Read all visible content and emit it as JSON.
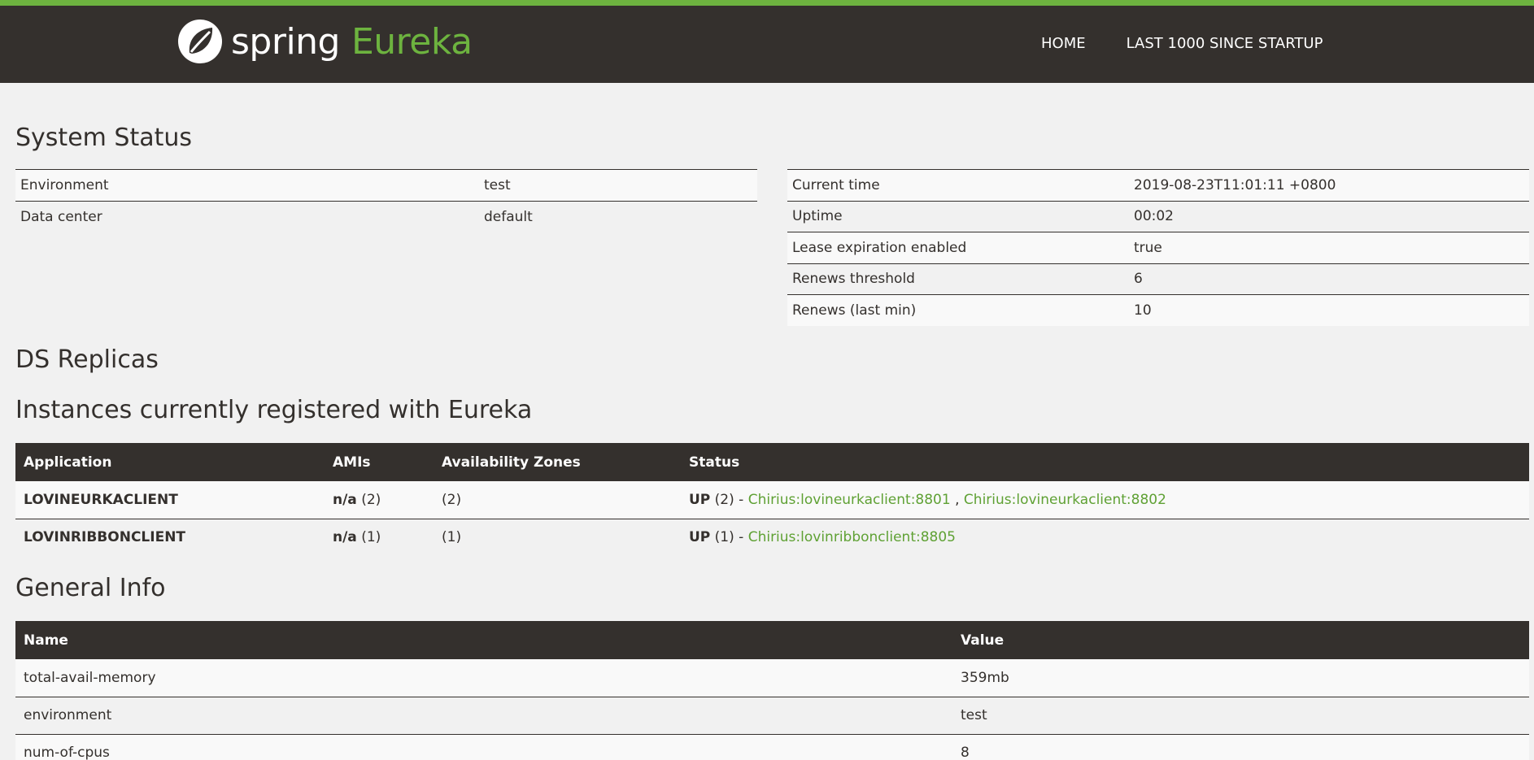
{
  "header": {
    "logo_word1": "spring",
    "logo_word2": "Eureka",
    "nav": [
      "HOME",
      "LAST 1000 SINCE STARTUP"
    ]
  },
  "system_status": {
    "title": "System Status",
    "left": [
      {
        "label": "Environment",
        "value": "test"
      },
      {
        "label": "Data center",
        "value": "default"
      }
    ],
    "right": [
      {
        "label": "Current time",
        "value": "2019-08-23T11:01:11 +0800"
      },
      {
        "label": "Uptime",
        "value": "00:02"
      },
      {
        "label": "Lease expiration enabled",
        "value": "true"
      },
      {
        "label": "Renews threshold",
        "value": "6"
      },
      {
        "label": "Renews (last min)",
        "value": "10"
      }
    ]
  },
  "ds_replicas": {
    "title": "DS Replicas"
  },
  "instances": {
    "title": "Instances currently registered with Eureka",
    "headers": [
      "Application",
      "AMIs",
      "Availability Zones",
      "Status"
    ],
    "rows": [
      {
        "application": "LOVINEURKACLIENT",
        "ami_label": "n/a",
        "ami_count": "(2)",
        "zones": "(2)",
        "status": "UP",
        "status_count": "(2) -",
        "links": [
          "Chirius:lovineurkaclient:8801",
          "Chirius:lovineurkaclient:8802"
        ],
        "separator": ","
      },
      {
        "application": "LOVINRIBBONCLIENT",
        "ami_label": "n/a",
        "ami_count": "(1)",
        "zones": "(1)",
        "status": "UP",
        "status_count": "(1) -",
        "links": [
          "Chirius:lovinribbonclient:8805"
        ]
      }
    ]
  },
  "general_info": {
    "title": "General Info",
    "headers": [
      "Name",
      "Value"
    ],
    "rows": [
      {
        "name": "total-avail-memory",
        "value": "359mb"
      },
      {
        "name": "environment",
        "value": "test"
      },
      {
        "name": "num-of-cpus",
        "value": "8"
      }
    ]
  },
  "colors": {
    "accent": "#6db33f",
    "header_bg": "#34302d",
    "page_bg": "#f1f1f1",
    "link": "#5fa134"
  }
}
